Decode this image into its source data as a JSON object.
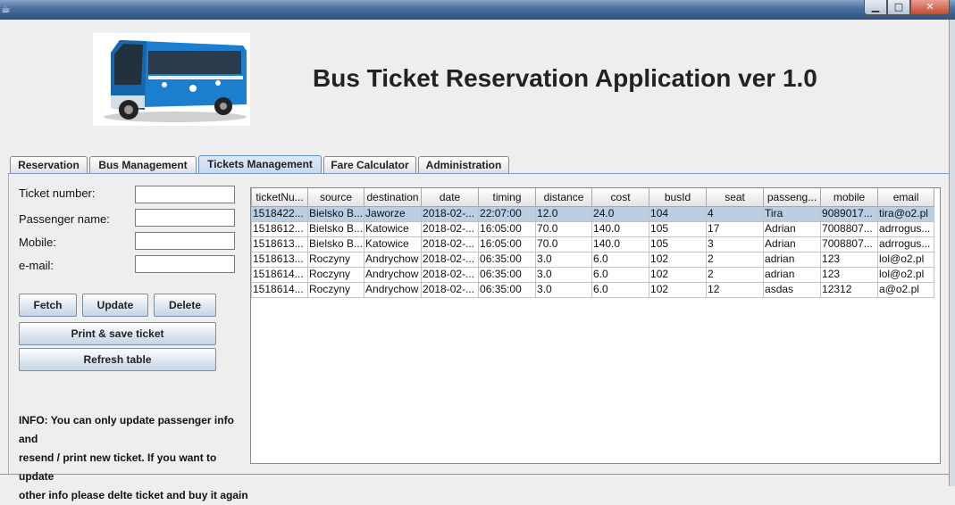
{
  "window": {
    "icon": "java-cup-icon",
    "buttons": {
      "minimize": "▁",
      "maximize": "□",
      "close": "✕"
    }
  },
  "header": {
    "title": "Bus Ticket Reservation Application ver 1.0",
    "logo": "bus-photo"
  },
  "tabs": [
    {
      "label": "Reservation",
      "active": false
    },
    {
      "label": "Bus Management",
      "active": false
    },
    {
      "label": "Tickets Management",
      "active": true
    },
    {
      "label": "Fare Calculator",
      "active": false
    },
    {
      "label": "Administration",
      "active": false
    }
  ],
  "form": {
    "ticket_number_label": "Ticket number:",
    "ticket_number_value": "",
    "passenger_name_label": "Passenger name:",
    "passenger_name_value": "",
    "mobile_label": "Mobile:",
    "mobile_value": "",
    "email_label": "e-mail:",
    "email_value": ""
  },
  "buttons": {
    "fetch": "Fetch",
    "update": "Update",
    "delete": "Delete",
    "print_save": "Print & save ticket",
    "refresh": "Refresh table"
  },
  "info": {
    "line1": "INFO: You can only update passenger info and",
    "line2": "resend / print new ticket. If you want to update",
    "line3": "other info please delte ticket and buy it again"
  },
  "table": {
    "headers": [
      "ticketNu...",
      "source",
      "destination",
      "date",
      "timing",
      "distance",
      "cost",
      "busId",
      "seat",
      "passeng...",
      "mobile",
      "email"
    ],
    "selected_row": 0,
    "rows": [
      [
        "1518422...",
        "Bielsko B...",
        "Jaworze",
        "2018-02-...",
        "22:07:00",
        "12.0",
        "24.0",
        "104",
        "4",
        "Tira",
        "9089017...",
        "tira@o2.pl"
      ],
      [
        "1518612...",
        "Bielsko B...",
        "Katowice",
        "2018-02-...",
        "16:05:00",
        "70.0",
        "140.0",
        "105",
        "17",
        "Adrian",
        "7008807...",
        "adrrogus..."
      ],
      [
        "1518613...",
        "Bielsko B...",
        "Katowice",
        "2018-02-...",
        "16:05:00",
        "70.0",
        "140.0",
        "105",
        "3",
        "Adrian",
        "7008807...",
        "adrrogus..."
      ],
      [
        "1518613...",
        "Roczyny",
        "Andrychow",
        "2018-02-...",
        "06:35:00",
        "3.0",
        "6.0",
        "102",
        "2",
        "adrian",
        "123",
        "lol@o2.pl"
      ],
      [
        "1518614...",
        "Roczyny",
        "Andrychow",
        "2018-02-...",
        "06:35:00",
        "3.0",
        "6.0",
        "102",
        "2",
        "adrian",
        "123",
        "lol@o2.pl"
      ],
      [
        "1518614...",
        "Roczyny",
        "Andrychow",
        "2018-02-...",
        "06:35:00",
        "3.0",
        "6.0",
        "102",
        "12",
        "asdas",
        "12312",
        "a@o2.pl"
      ]
    ]
  }
}
